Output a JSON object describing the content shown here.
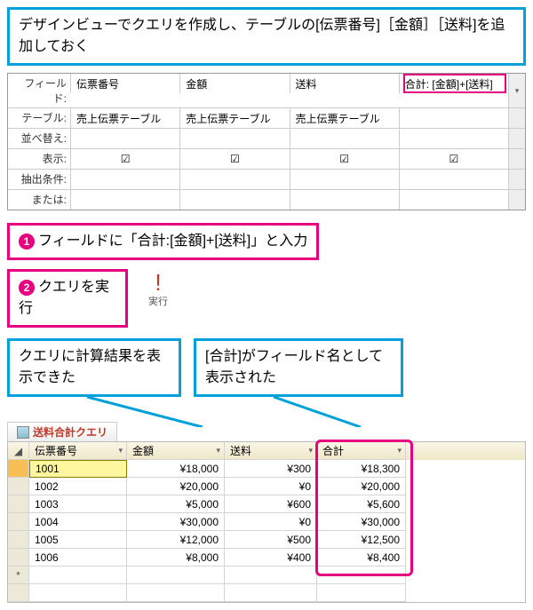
{
  "callouts": {
    "pre": "デザインビューでクエリを作成し、テーブルの[伝票番号]［金額］［送料]を追加しておく",
    "step1": "フィールドに「合計:[金額]+[送料]」と入力",
    "step2": "クエリを実行",
    "result1": "クエリに計算結果を表示できた",
    "result2": "[合計]がフィールド名として表示された",
    "num1": "1",
    "num2": "2"
  },
  "design_grid": {
    "labels": [
      "フィールド:",
      "テーブル:",
      "並べ替え:",
      "表示:",
      "抽出条件:",
      "または:"
    ],
    "cols": [
      {
        "field": "伝票番号",
        "table": "売上伝票テーブル",
        "show": true
      },
      {
        "field": "金額",
        "table": "売上伝票テーブル",
        "show": true
      },
      {
        "field": "送料",
        "table": "売上伝票テーブル",
        "show": true
      },
      {
        "field": "合計: [金額]+[送料]",
        "table": "",
        "show": true
      }
    ]
  },
  "exec_btn": {
    "label": "実行",
    "icon": "!"
  },
  "query_tab": "送料合計クエリ",
  "datasheet": {
    "headers": [
      "伝票番号",
      "金額",
      "送料",
      "合計"
    ],
    "rows": [
      {
        "id": "1001",
        "amount": "¥18,000",
        "ship": "¥300",
        "total": "¥18,300"
      },
      {
        "id": "1002",
        "amount": "¥20,000",
        "ship": "¥0",
        "total": "¥20,000"
      },
      {
        "id": "1003",
        "amount": "¥5,000",
        "ship": "¥600",
        "total": "¥5,600"
      },
      {
        "id": "1004",
        "amount": "¥30,000",
        "ship": "¥0",
        "total": "¥30,000"
      },
      {
        "id": "1005",
        "amount": "¥12,000",
        "ship": "¥500",
        "total": "¥12,500"
      },
      {
        "id": "1006",
        "amount": "¥8,000",
        "ship": "¥400",
        "total": "¥8,400"
      }
    ],
    "new_row": "*"
  }
}
